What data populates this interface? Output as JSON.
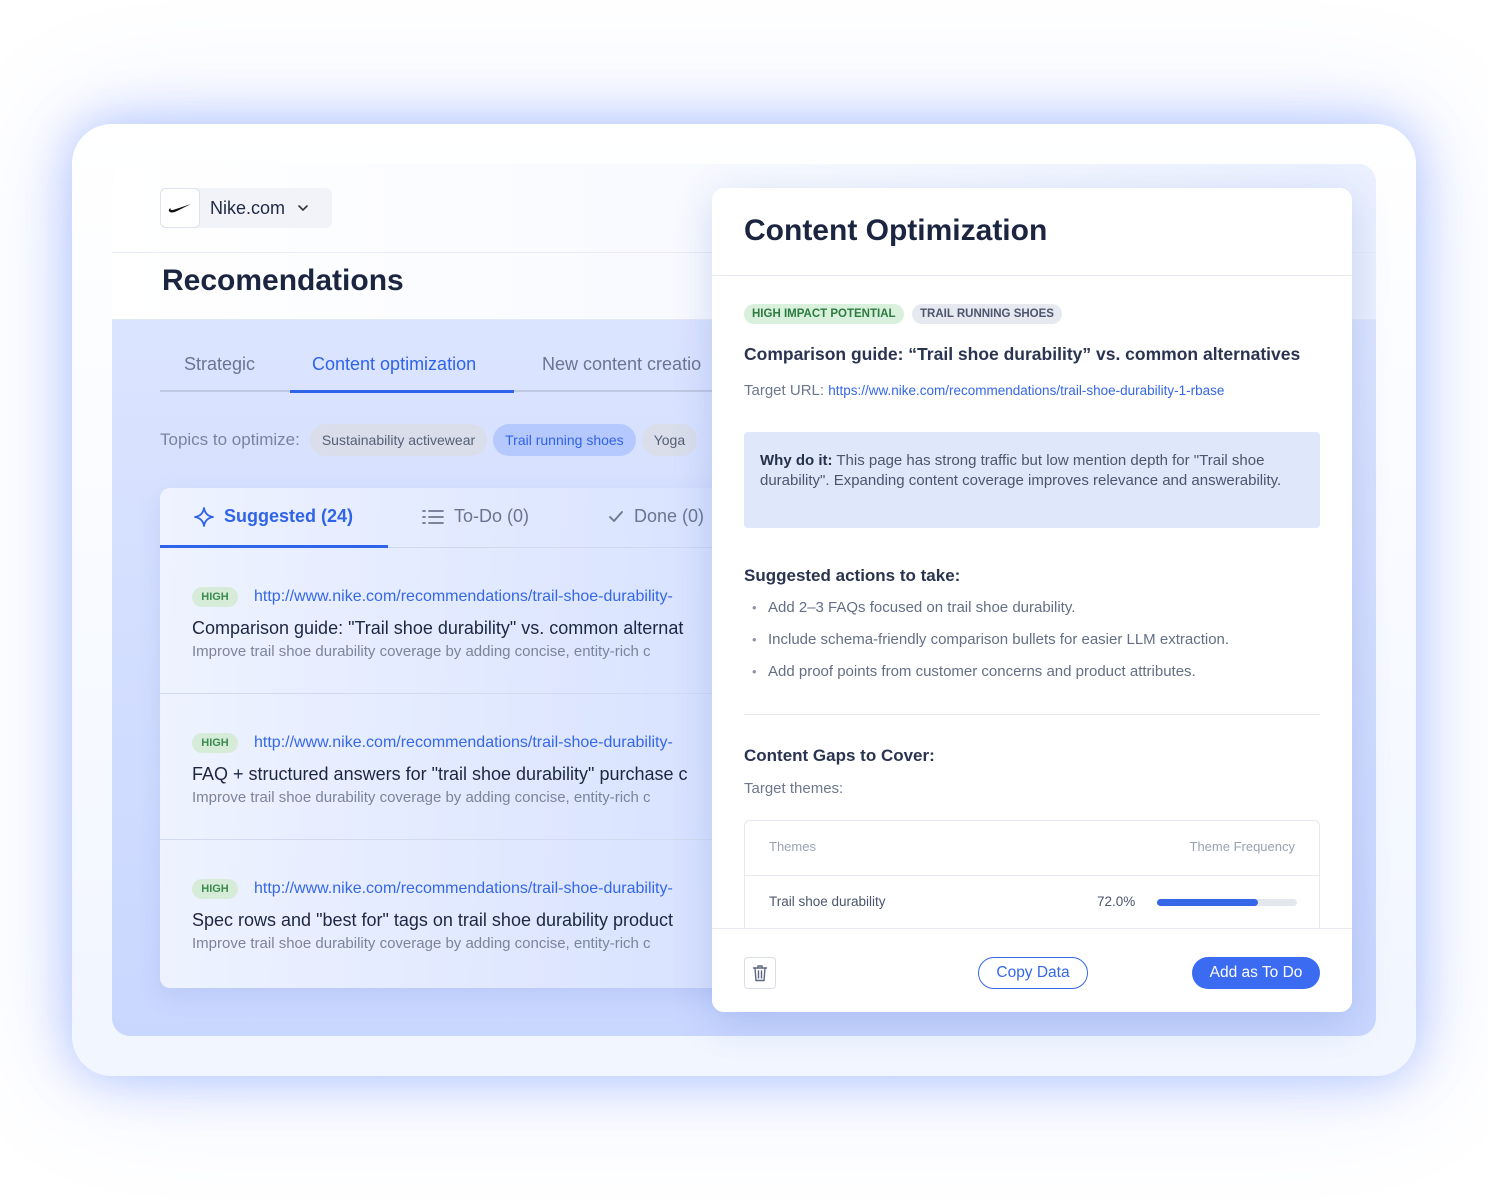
{
  "site": {
    "name": "Nike.com",
    "logo_icon": "nike-swoosh-icon"
  },
  "page": {
    "title": "Recomendations"
  },
  "tabs": [
    {
      "label": "Strategic"
    },
    {
      "label": "Content optimization"
    },
    {
      "label": "New content creatio"
    }
  ],
  "topics": {
    "label": "Topics to optimize:",
    "chips": [
      {
        "label": "Sustainability activewear"
      },
      {
        "label": "Trail running shoes"
      },
      {
        "label": "Yoga"
      }
    ]
  },
  "list_tabs": [
    {
      "label": "Suggested (24)",
      "icon": "sparkle-icon"
    },
    {
      "label": "To-Do (0)",
      "icon": "list-icon"
    },
    {
      "label": "Done (0)",
      "icon": "check-icon"
    }
  ],
  "recommendations": [
    {
      "priority": "HIGH",
      "url": "http://www.nike.com/recommendations/trail-shoe-durability-",
      "title": "Comparison guide: \"Trail shoe durability\" vs. common alternat",
      "desc": "Improve trail shoe durability coverage by adding concise, entity-rich c"
    },
    {
      "priority": "HIGH",
      "url": "http://www.nike.com/recommendations/trail-shoe-durability-",
      "title": "FAQ + structured answers for \"trail shoe durability\" purchase c",
      "desc": "Improve trail shoe durability coverage by adding concise, entity-rich c"
    },
    {
      "priority": "HIGH",
      "url": "http://www.nike.com/recommendations/trail-shoe-durability-",
      "title": "Spec rows and \"best for\" tags on trail shoe durability product",
      "desc": "Improve trail shoe durability coverage by adding concise, entity-rich c"
    }
  ],
  "detail": {
    "title": "Content Optimization",
    "tags": [
      "HIGH IMPACT POTENTIAL",
      "TRAIL RUNNING SHOES"
    ],
    "heading": "Comparison guide: “Trail shoe durability” vs. common alternatives",
    "target_url_label": "Target URL:",
    "target_url": "https://ww.nike.com/recommendations/trail-shoe-durability-1-rbase",
    "why_label": "Why do it:",
    "why_text": " This page has strong traffic but low mention depth for \"Trail shoe durability\". Expanding content coverage improves relevance and answerability.",
    "actions_title": "Suggested actions to take:",
    "actions": [
      "Add 2–3 FAQs focused on trail shoe durability.",
      "Include schema-friendly comparison bullets for easier LLM extraction.",
      "Add proof points from customer concerns and product attributes."
    ],
    "gaps_title": "Content Gaps to Cover:",
    "gaps_sub": "Target themes:",
    "table": {
      "col_theme": "Themes",
      "col_freq": "Theme Frequency",
      "rows": [
        {
          "theme": "Trail shoe durability",
          "pct_label": "72.0%",
          "value": 0.72
        }
      ]
    },
    "footer": {
      "copy_label": "Copy Data",
      "add_label": "Add as To Do"
    }
  },
  "colors": {
    "accent": "#3567e6",
    "success": "#2d7b41"
  }
}
